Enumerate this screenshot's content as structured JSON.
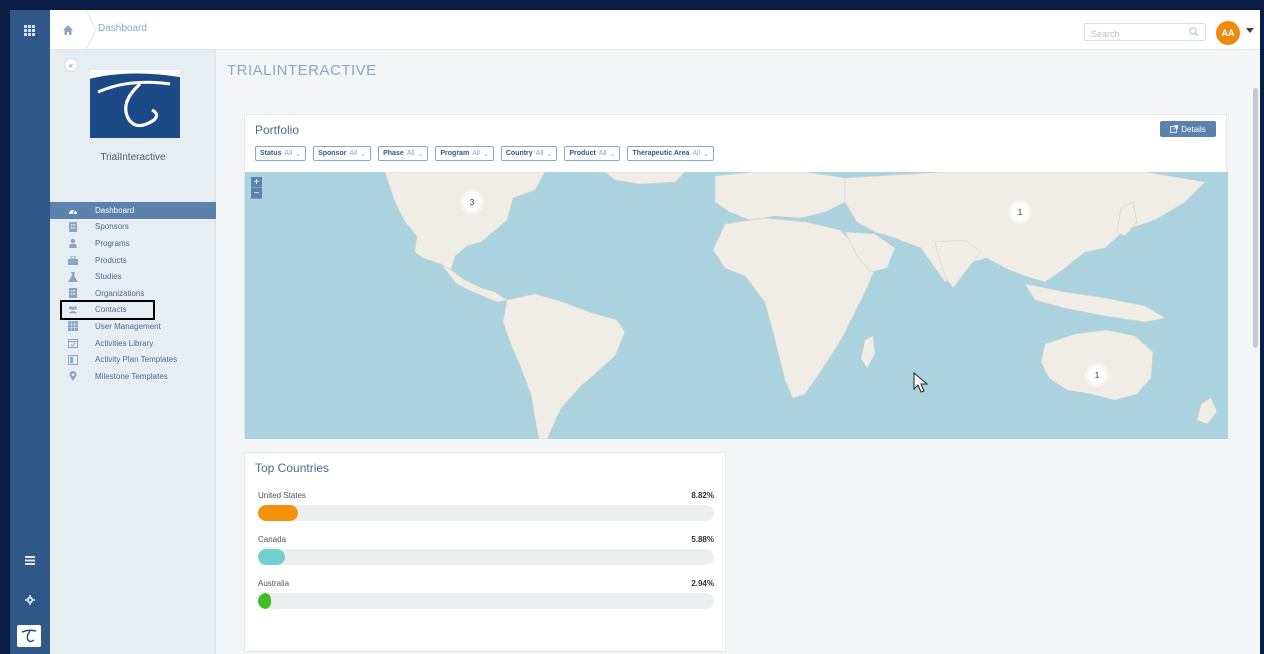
{
  "header": {
    "breadcrumb": "Dashboard",
    "search_placeholder": "Search",
    "avatar_initials": "AA"
  },
  "sidebar": {
    "brand_name": "TrialInteractive",
    "items": [
      {
        "label": "Dashboard",
        "icon": "dashboard-icon",
        "active": true
      },
      {
        "label": "Sponsors",
        "icon": "sponsors-icon"
      },
      {
        "label": "Programs",
        "icon": "programs-icon"
      },
      {
        "label": "Products",
        "icon": "products-icon"
      },
      {
        "label": "Studies",
        "icon": "studies-icon"
      },
      {
        "label": "Organizations",
        "icon": "organizations-icon"
      },
      {
        "label": "Contacts",
        "icon": "contacts-icon"
      },
      {
        "label": "User Management",
        "icon": "user-management-icon"
      },
      {
        "label": "Activities Library",
        "icon": "activities-library-icon"
      },
      {
        "label": "Activity Plan Templates",
        "icon": "activity-plan-icon"
      },
      {
        "label": "Milestone Templates",
        "icon": "milestone-icon"
      }
    ]
  },
  "main": {
    "page_title": "TRIALINTERACTIVE",
    "portfolio": {
      "title": "Portfolio",
      "details_label": "Details",
      "filters": [
        {
          "label": "Status",
          "value": "All"
        },
        {
          "label": "Sponsor",
          "value": "All"
        },
        {
          "label": "Phase",
          "value": "All"
        },
        {
          "label": "Program",
          "value": "All"
        },
        {
          "label": "Country",
          "value": "All"
        },
        {
          "label": "Product",
          "value": "All"
        },
        {
          "label": "Therapeutic Area",
          "value": "All"
        }
      ],
      "map_clusters": [
        {
          "count": "3",
          "region": "North America"
        },
        {
          "count": "1",
          "region": "Asia"
        },
        {
          "count": "1",
          "region": "Australia"
        }
      ]
    },
    "top_countries": {
      "title": "Top Countries",
      "rows": [
        {
          "name": "United States",
          "percent": "8.82%",
          "value": 8.82,
          "color": "#f5900b"
        },
        {
          "name": "Canada",
          "percent": "5.88%",
          "value": 5.88,
          "color": "#6fd0cf"
        },
        {
          "name": "Australia",
          "percent": "2.94%",
          "value": 2.94,
          "color": "#3fbf25"
        }
      ]
    }
  }
}
